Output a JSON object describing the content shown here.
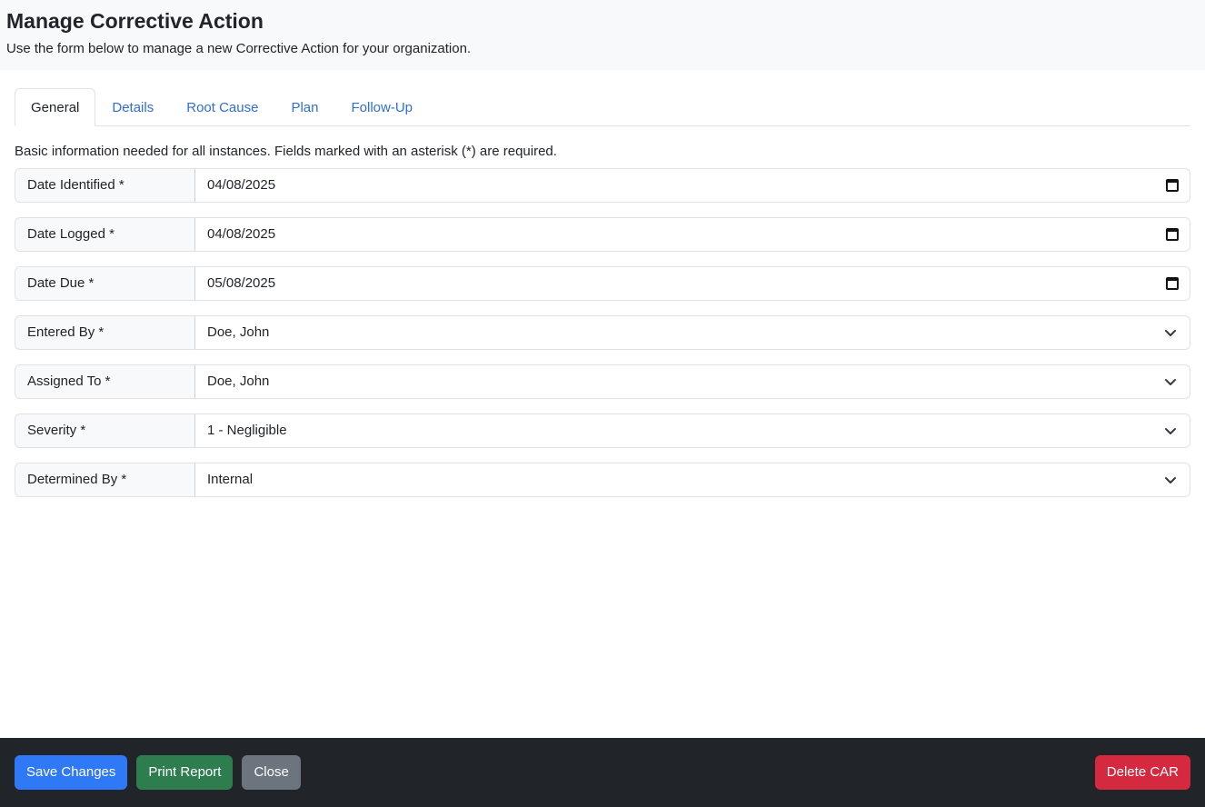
{
  "header": {
    "title": "Manage Corrective Action",
    "subtitle": "Use the form below to manage a new Corrective Action for your organization."
  },
  "tabs": [
    {
      "label": "General",
      "active": true
    },
    {
      "label": "Details",
      "active": false
    },
    {
      "label": "Root Cause",
      "active": false
    },
    {
      "label": "Plan",
      "active": false
    },
    {
      "label": "Follow-Up",
      "active": false
    }
  ],
  "form": {
    "help_text": "Basic information needed for all instances. Fields marked with an asterisk (*) are required.",
    "fields": [
      {
        "label": "Date Identified *",
        "value": "04/08/2025",
        "kind": "date",
        "icon": "calendar-icon"
      },
      {
        "label": "Date Logged *",
        "value": "04/08/2025",
        "kind": "date",
        "icon": "calendar-icon"
      },
      {
        "label": "Date Due *",
        "value": "05/08/2025",
        "kind": "date",
        "icon": "calendar-icon"
      },
      {
        "label": "Entered By *",
        "value": "Doe, John",
        "kind": "select",
        "icon": "chevron-down-icon"
      },
      {
        "label": "Assigned To *",
        "value": "Doe, John",
        "kind": "select",
        "icon": "chevron-down-icon"
      },
      {
        "label": "Severity *",
        "value": "1 - Negligible",
        "kind": "select",
        "icon": "chevron-down-icon"
      },
      {
        "label": "Determined By *",
        "value": "Internal",
        "kind": "select",
        "icon": "chevron-down-icon"
      }
    ]
  },
  "footer": {
    "save_label": "Save Changes",
    "print_label": "Print Report",
    "close_label": "Close",
    "delete_label": "Delete CAR"
  },
  "colors": {
    "primary": "#2f78f6",
    "success": "#2e7d4f",
    "secondary": "#6c757d",
    "danger": "#d5293f",
    "footer_bg": "#212529",
    "link": "#2f6fd6"
  }
}
